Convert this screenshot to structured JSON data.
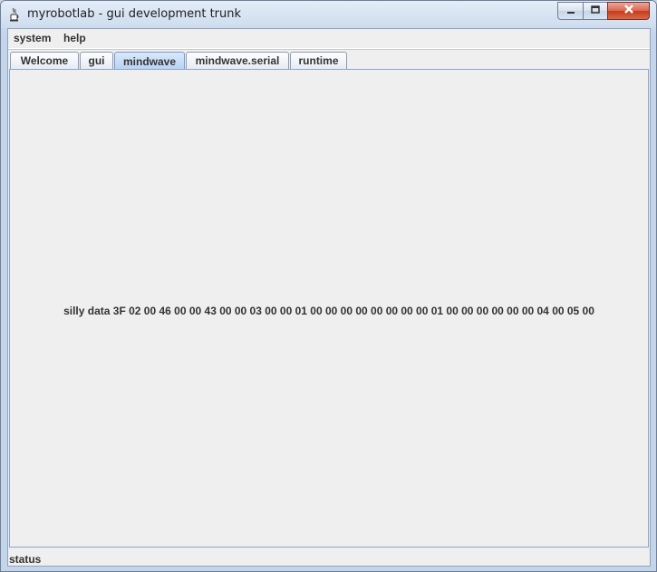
{
  "window": {
    "title": "myrobotlab - gui development trunk"
  },
  "menu": {
    "items": [
      {
        "label": "system"
      },
      {
        "label": "help"
      }
    ]
  },
  "tabs": [
    {
      "label": "Welcome",
      "active": false
    },
    {
      "label": "gui",
      "active": false
    },
    {
      "label": "mindwave",
      "active": true
    },
    {
      "label": "mindwave.serial",
      "active": false
    },
    {
      "label": "runtime",
      "active": false
    }
  ],
  "content": {
    "data_text": "silly data 3F 02 00 46 00 00 43 00 00 03 00 00 01 00 00 00 00 00 00 00 00 01 00 00 00 00 00 00 04 00 05 00"
  },
  "status": {
    "text": "status"
  },
  "colors": {
    "active_tab": "#b8d2f2",
    "close_button": "#c7391d"
  }
}
